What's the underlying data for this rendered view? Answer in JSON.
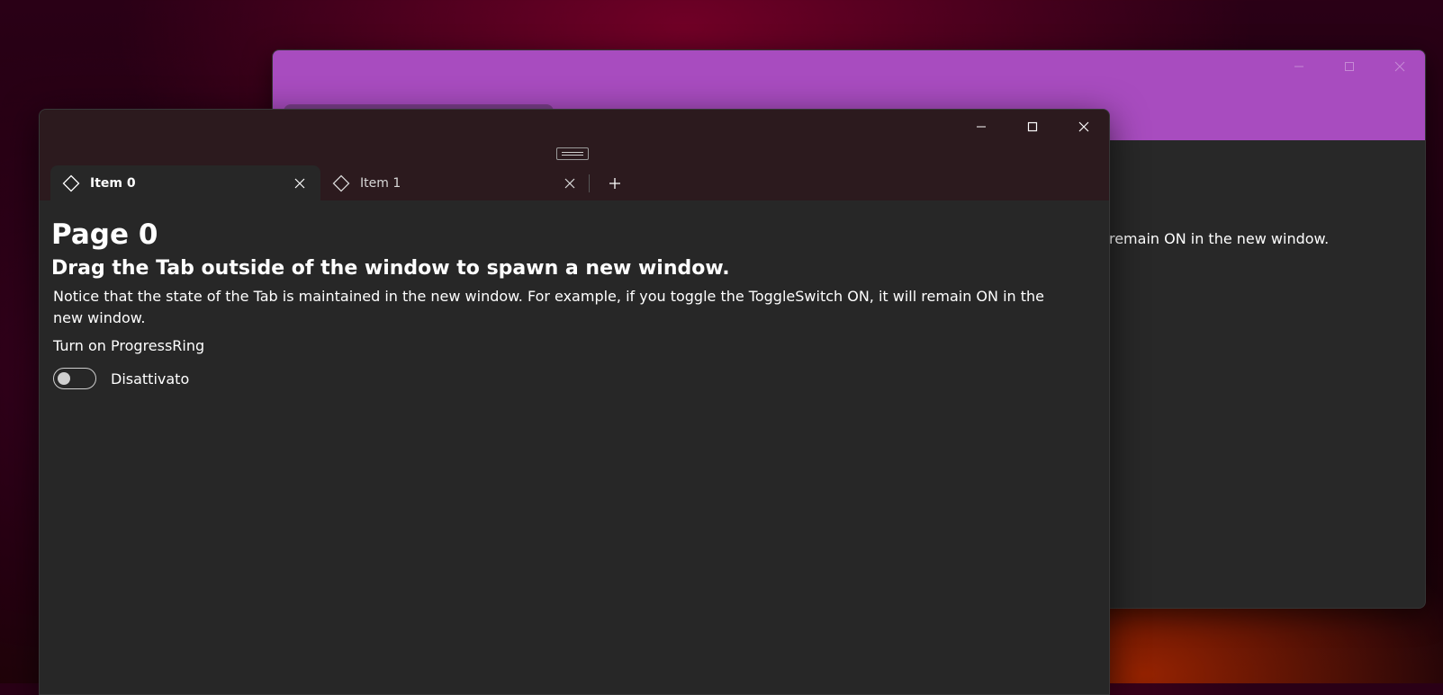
{
  "back_window": {
    "body_text_fragment": "ll remain ON in the new window."
  },
  "window": {
    "caption_buttons": {
      "minimize_icon": "minimize-icon",
      "maximize_icon": "maximize-icon",
      "close_icon": "close-icon"
    },
    "tabs": [
      {
        "label": "Item 0",
        "icon": "diamond-icon",
        "selected": true
      },
      {
        "label": "Item 1",
        "icon": "diamond-icon",
        "selected": false
      }
    ],
    "add_tab_icon": "plus-icon"
  },
  "page": {
    "title": "Page 0",
    "subtitle": "Drag the Tab outside of the window to spawn a new window.",
    "notice": "Notice that the state of the Tab is maintained in the new window. For example, if you toggle the ToggleSwitch ON, it will remain ON in the new window.",
    "toggle_header": "Turn on ProgressRing",
    "toggle_state": "Disattivato",
    "toggle_on": false
  },
  "colors": {
    "back_titlebar": "#a84cbf",
    "front_titlebar": "#2c1a1e",
    "content_bg": "#272727",
    "text": "#ffffff"
  }
}
